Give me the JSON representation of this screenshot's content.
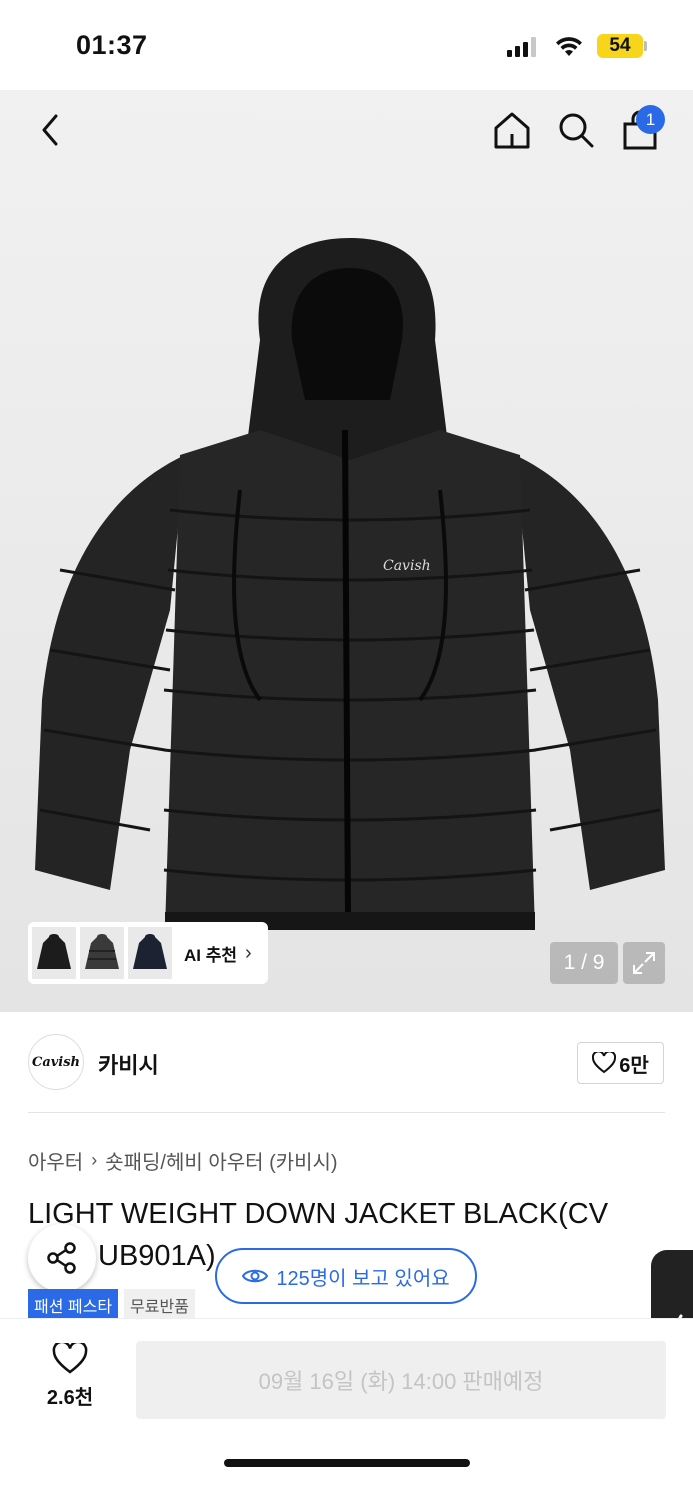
{
  "status": {
    "time": "01:37",
    "battery": "54"
  },
  "header": {
    "cart_count": "1"
  },
  "gallery": {
    "ai_recommend": "AI 추천",
    "page": "1 / 9"
  },
  "brand": {
    "logo_text": "Cavish",
    "name": "카비시",
    "likes": "6만"
  },
  "breadcrumb": [
    "아우터",
    "숏패딩/헤비 아우터 (카비시)"
  ],
  "product": {
    "title": "LIGHT WEIGHT DOWN JACKET BLACK(CVUB901A)",
    "title_line1": "LIGHT WEIGHT DOWN JACKET BLACK(CV",
    "title_line2": "UB901A)",
    "viewers": "125명이 보고 있어요",
    "tags": [
      "패션 페스타",
      "무료반품"
    ]
  },
  "bottom": {
    "wish_count": "2.6천",
    "buy_label": "09월 16일 (화) 14:00 판매예정"
  },
  "colors": {
    "accent": "#2a6ae6",
    "battery": "#f6d51a"
  }
}
